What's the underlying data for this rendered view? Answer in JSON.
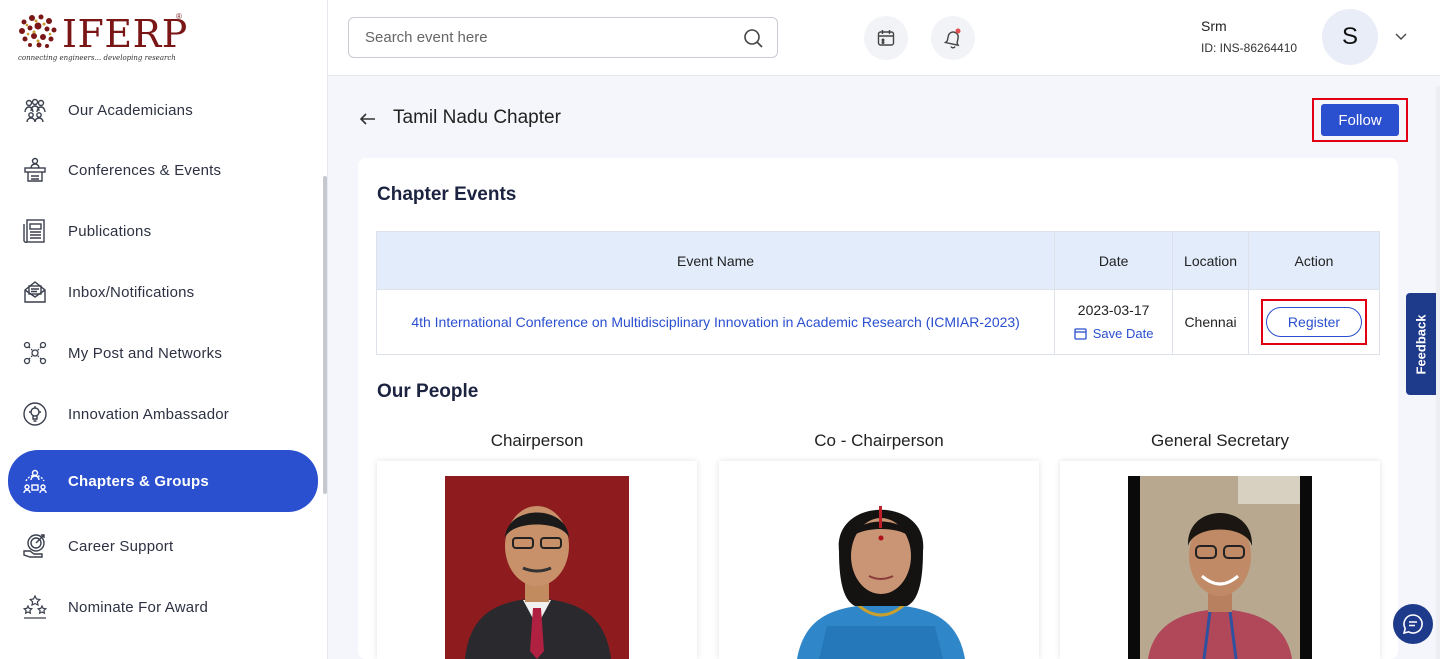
{
  "brand": {
    "name": "IFERP",
    "tagline": "connecting engineers... developing research",
    "reg_mark": "®"
  },
  "sidebar": {
    "items": [
      {
        "label": "Our Academicians",
        "icon": "academicians-icon"
      },
      {
        "label": "Conferences & Events",
        "icon": "conference-icon"
      },
      {
        "label": "Publications",
        "icon": "publications-icon"
      },
      {
        "label": "Inbox/Notifications",
        "icon": "inbox-icon"
      },
      {
        "label": "My Post and Networks",
        "icon": "network-icon"
      },
      {
        "label": "Innovation Ambassador",
        "icon": "innovation-icon"
      },
      {
        "label": "Chapters & Groups",
        "icon": "chapters-icon",
        "active": true
      },
      {
        "label": "Career Support",
        "icon": "career-icon"
      },
      {
        "label": "Nominate For Award",
        "icon": "award-icon"
      }
    ]
  },
  "header": {
    "search_placeholder": "Search event here",
    "user_name": "Srm",
    "user_id": "ID: INS-86264410",
    "avatar_letter": "S"
  },
  "page": {
    "title": "Tamil Nadu Chapter",
    "follow_label": "Follow"
  },
  "events": {
    "section_title": "Chapter Events",
    "columns": [
      "Event Name",
      "Date",
      "Location",
      "Action"
    ],
    "rows": [
      {
        "name": "4th International Conference on Multidisciplinary Innovation in Academic Research (ICMIAR-2023)",
        "date": "2023-03-17",
        "save_label": "Save Date",
        "location": "Chennai",
        "action_label": "Register"
      }
    ]
  },
  "people": {
    "section_title": "Our People",
    "roles": [
      "Chairperson",
      "Co - Chairperson",
      "General Secretary"
    ]
  },
  "widgets": {
    "feedback_label": "Feedback"
  },
  "colors": {
    "primary": "#2a4fcf",
    "highlight": "#e00012",
    "brand": "#7a1616",
    "feedback": "#1e3a8a"
  }
}
